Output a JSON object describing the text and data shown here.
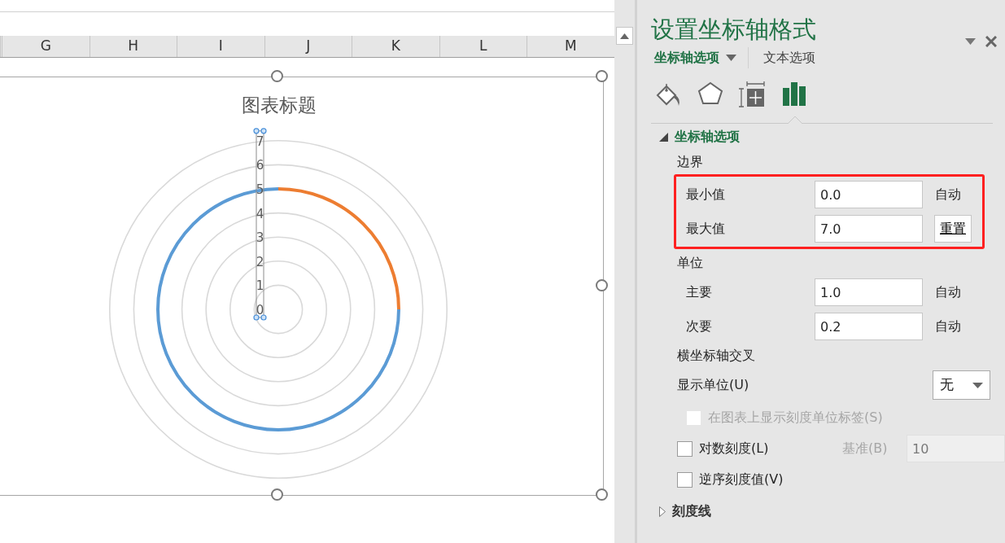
{
  "spreadsheet": {
    "columns": [
      "G",
      "H",
      "I",
      "J",
      "K",
      "L",
      "M"
    ]
  },
  "chart": {
    "title": "图表标题",
    "axis_labels": [
      "7",
      "6",
      "5",
      "4",
      "3",
      "2",
      "1",
      "0"
    ]
  },
  "pane": {
    "title": "设置坐标轴格式",
    "tabs": [
      {
        "label": "坐标轴选项",
        "selected": true
      },
      {
        "label": "文本选项",
        "selected": false
      }
    ],
    "icon_tabs": [
      {
        "kind": "fill",
        "selected": false
      },
      {
        "kind": "effects",
        "selected": false
      },
      {
        "kind": "size",
        "selected": false
      },
      {
        "kind": "options",
        "selected": true
      }
    ],
    "section": {
      "title": "坐标轴选项",
      "expanded": true
    },
    "bounds_label": "边界",
    "bounds": [
      {
        "kind": "text",
        "label": "最小值",
        "value": "0.0",
        "action": "自动"
      },
      {
        "kind": "button",
        "label": "最大值",
        "value": "7.0",
        "action": "重置"
      }
    ],
    "units_label": "单位",
    "units": [
      {
        "kind": "text",
        "label": "主要",
        "value": "1.0",
        "action": "自动"
      },
      {
        "kind": "text",
        "label": "次要",
        "value": "0.2",
        "action": "自动"
      }
    ],
    "cross_label": "横坐标轴交叉",
    "display_unit": {
      "label": "显示单位(U)",
      "value": "无"
    },
    "checkboxes": [
      {
        "label": "在图表上显示刻度单位标签(S)",
        "checked": false,
        "disabled": true
      },
      {
        "label": "对数刻度(L)",
        "checked": false,
        "disabled": false,
        "base_label": "基准(B)",
        "base_value": "10"
      },
      {
        "label": "逆序刻度值(V)",
        "checked": false,
        "disabled": false
      }
    ],
    "collapsed_section": {
      "title": "刻度线",
      "expanded": false
    }
  }
}
